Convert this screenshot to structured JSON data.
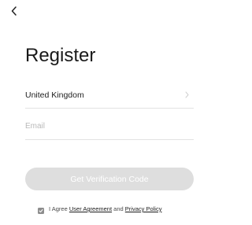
{
  "header": {
    "back_icon": "chevron-left-icon"
  },
  "page": {
    "title": "Register"
  },
  "form": {
    "country": {
      "value": "United Kingdom",
      "chevron_icon": "chevron-right-icon"
    },
    "email": {
      "value": "",
      "placeholder": "Email"
    },
    "verify_button_label": "Get Verification Code"
  },
  "agreement": {
    "checked": true,
    "prefix": "I Agree",
    "user_agreement_label": "User Agreement",
    "and_text": "and",
    "privacy_policy_label": "Privacy Policy"
  },
  "colors": {
    "button_disabled_bg": "#dedede",
    "divider": "#e2e2e2",
    "placeholder": "#b9b9b9",
    "checkbox": "#8d8d8d"
  }
}
